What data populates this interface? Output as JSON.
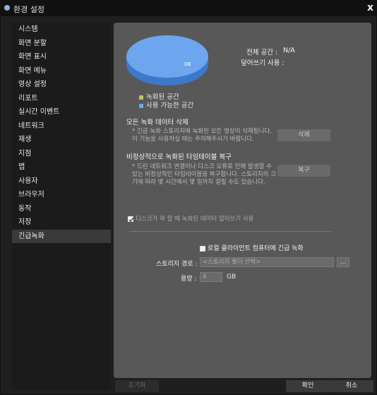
{
  "window": {
    "title": "환경 설정",
    "close": "x"
  },
  "sidebar": {
    "items": [
      {
        "label": "시스템"
      },
      {
        "label": "화면 분할"
      },
      {
        "label": "화면 표시"
      },
      {
        "label": "화면 메뉴"
      },
      {
        "label": "영상 설정"
      },
      {
        "label": "리포트"
      },
      {
        "label": "실시간 이벤트"
      },
      {
        "label": "네트워크"
      },
      {
        "label": "재생"
      },
      {
        "label": "지점"
      },
      {
        "label": "맵"
      },
      {
        "label": "사용자"
      },
      {
        "label": "브라우저"
      },
      {
        "label": "동작"
      },
      {
        "label": "저장"
      },
      {
        "label": "긴급녹화"
      }
    ],
    "selected_index": 15
  },
  "storage": {
    "pie_label": "0B",
    "total_label": "전체 공간 :",
    "total_value": "N/A",
    "overwrite_label": "덮어쓰기 사용 :",
    "overwrite_value": "",
    "legend": [
      {
        "label": "녹화된 공간",
        "color": "#b5c96a"
      },
      {
        "label": "사용 가능한 공간",
        "color": "#6da6ee"
      }
    ]
  },
  "delete_section": {
    "title": "모든 녹화 데이터 삭제",
    "note": "* 긴급 녹화 스토리지에 녹화된 모든 영상이 삭제됩니다. 이 기능을 사용하실 때는 주의해주시기 바랍니다.",
    "button": "삭제"
  },
  "recover_section": {
    "title": "비정상적으로 녹화된 타임테이블 복구",
    "note": "* 드린 네트워크 연결이나 디스크 오류로 인해 발생할 수 있는 비정상적인 타임테이블을 복구합니다. 스토리지의 크기에 따라 몇 시간에서 몇 일까지 걸릴 수도 있습니다.",
    "button": "복구"
  },
  "overwrite_option": {
    "label": "디스크가 꽉 찰 때 녹화된 데이터 덮어쓰기 사용",
    "checked": true
  },
  "local_record": {
    "checkbox_label": "로컬 클라이언트 컴퓨터에 긴급 녹화",
    "checked": false,
    "path_label": "스토리지 경로 :",
    "path_placeholder": "<스토리지 폴더 선택>",
    "browse": "...",
    "capacity_label": "용량 :",
    "capacity_value": "4",
    "capacity_unit": "GB"
  },
  "footer": {
    "reset": "초기화",
    "ok": "확인",
    "cancel": "취소"
  }
}
